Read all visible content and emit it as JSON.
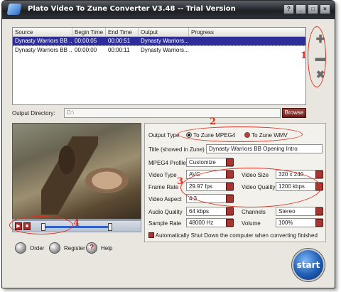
{
  "window": {
    "title": "Plato Video To Zune Converter V3.48 -- Trial Version"
  },
  "titlebar_buttons": [
    {
      "name": "help",
      "glyph": "?"
    },
    {
      "name": "minimize",
      "glyph": "_"
    },
    {
      "name": "maximize",
      "glyph": "□"
    },
    {
      "name": "close",
      "glyph": "×"
    }
  ],
  "file_list": {
    "columns": [
      "Source",
      "Begin Time",
      "End Time",
      "Output",
      "Progress"
    ],
    "rows": [
      {
        "source": "Dynasty Warriors BB ...",
        "begin": "00:00:05",
        "end": "00:00:51",
        "output": "Dynasty Warriors...",
        "progress": ""
      },
      {
        "source": "Dynasty Warriors BB ...",
        "begin": "00:00:00",
        "end": "00:00:11",
        "output": "Dynasty Warriors...",
        "progress": ""
      }
    ]
  },
  "side_buttons": {
    "add": "✚",
    "remove": "▬",
    "clear": "✖"
  },
  "output_dir": {
    "label": "Output Directory:",
    "value": "D:\\",
    "browse": "Browse"
  },
  "settings": {
    "output_type_label": "Output Type",
    "option_mpeg4": "To Zune MPEG4",
    "option_wmv": "To Zune WMV",
    "title_label": "Title (showed in Zune)",
    "title_value": "Dynasty Warriors BB Opening Intro",
    "profile_label": "MPEG4 Profile",
    "profile_value": "Customize",
    "video_type_label": "Video Type",
    "video_type_value": "AVC",
    "video_size_label": "Video Size",
    "video_size_value": "320 x 240",
    "frame_rate_label": "Frame Rate",
    "frame_rate_value": "29.97   fps",
    "video_quality_label": "Video Quality",
    "video_quality_value": "1200 kbps",
    "video_aspect_label": "Video Aspect",
    "video_aspect_value": "4:3",
    "audio_quality_label": "Audio Quality",
    "audio_quality_value": "64    kbps",
    "channels_label": "Channels",
    "channels_value": "Stereo",
    "sample_rate_label": "Sample Rate",
    "sample_rate_value": "48000  Hz",
    "volume_label": "Volume",
    "volume_value": "100%",
    "shutdown_label": "Automatically Shut Down the computer when converting finished"
  },
  "bottom": {
    "order": "Order",
    "register": "Register",
    "help": "Help",
    "start": "start"
  },
  "annotations": [
    "1",
    "2",
    "3",
    "4"
  ],
  "colors": {
    "accent_red": "#a83630",
    "selection_blue": "#2e2e9a",
    "annotation_red": "#e03020"
  }
}
